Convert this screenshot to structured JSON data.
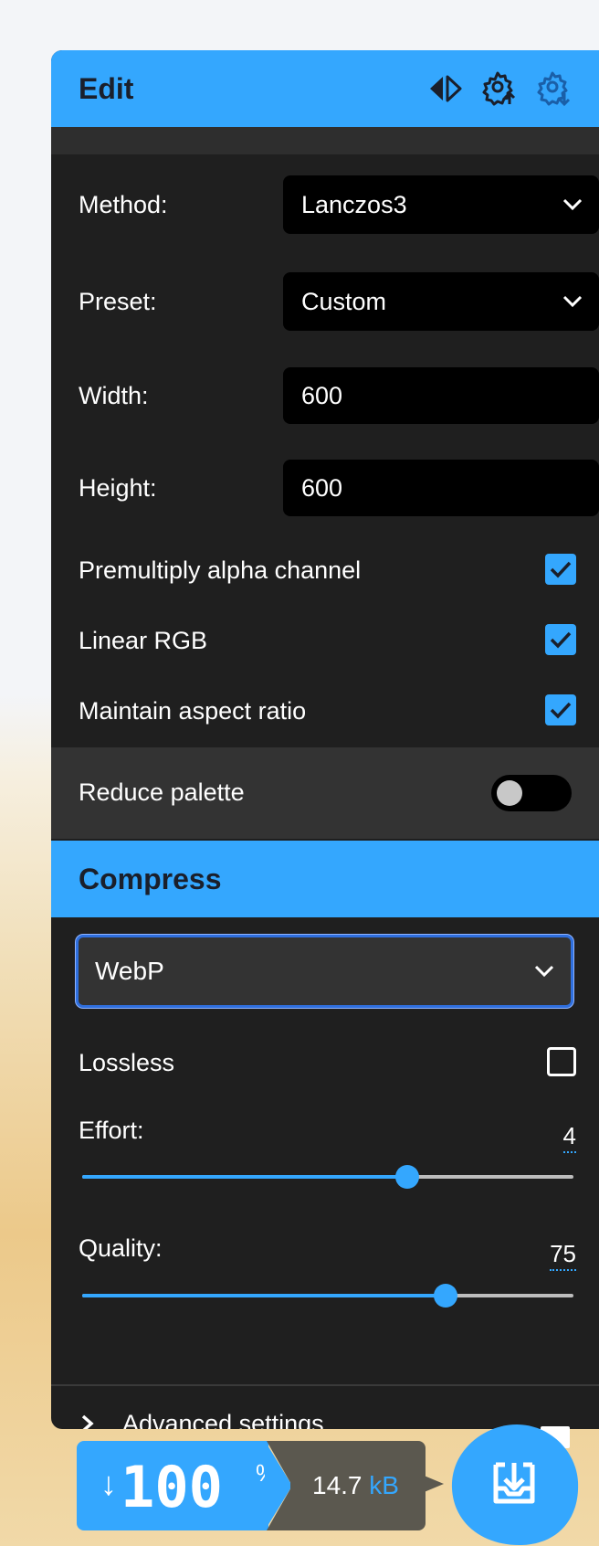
{
  "edit": {
    "title": "Edit",
    "icons": [
      "compare-icon",
      "import-settings-icon",
      "export-settings-icon"
    ],
    "method": {
      "label": "Method:",
      "value": "Lanczos3"
    },
    "preset": {
      "label": "Preset:",
      "value": "Custom"
    },
    "width": {
      "label": "Width:",
      "value": "600"
    },
    "height": {
      "label": "Height:",
      "value": "600"
    },
    "premultiply": {
      "label": "Premultiply alpha channel",
      "checked": true
    },
    "linear_rgb": {
      "label": "Linear RGB",
      "checked": true
    },
    "maintain_aspect": {
      "label": "Maintain aspect ratio",
      "checked": true
    },
    "reduce_palette": {
      "label": "Reduce palette",
      "on": false
    }
  },
  "compress": {
    "title": "Compress",
    "codec": "WebP",
    "lossless": {
      "label": "Lossless",
      "checked": false
    },
    "effort": {
      "label": "Effort:",
      "value": "4",
      "level": 0.66
    },
    "quality": {
      "label": "Quality:",
      "value": "75",
      "level": 0.74
    },
    "advanced_label": "Advanced settings"
  },
  "result": {
    "arrow": "↓",
    "percent": "100",
    "percent_unit": "%",
    "size": "14.7",
    "size_unit": "kB"
  },
  "colors": {
    "accent": "#34a7fe",
    "panel": "#1f1f1f",
    "size_box": "#5b584f"
  }
}
